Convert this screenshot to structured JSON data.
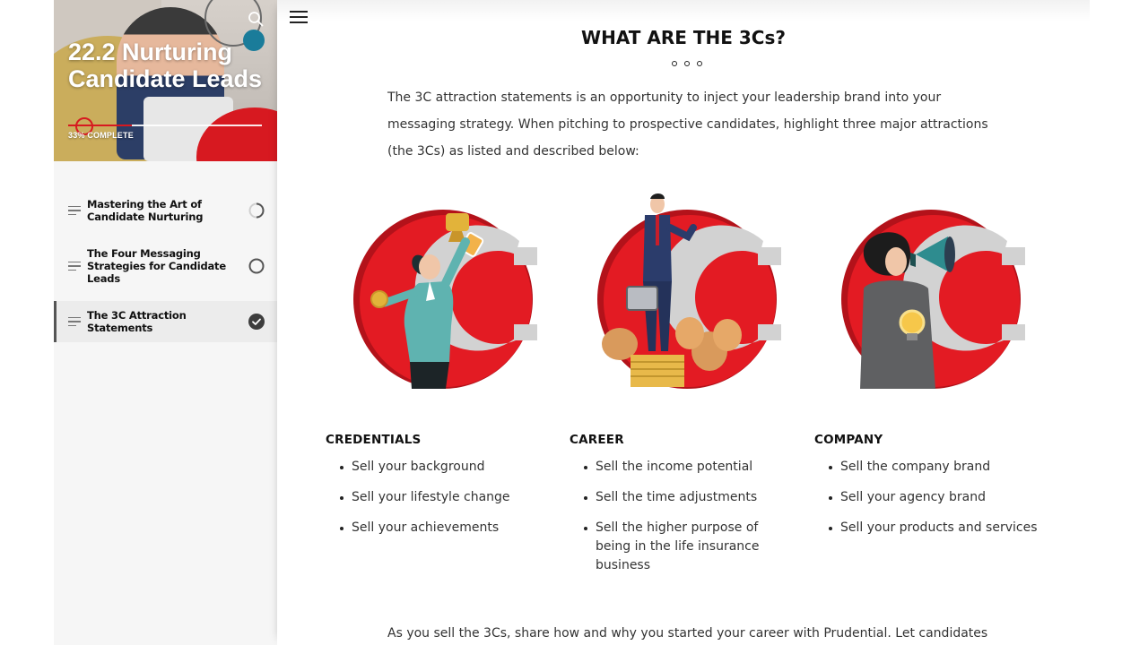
{
  "sidebar": {
    "lesson_title": "22.2 Nurturing Candidate Leads",
    "progress_percent": 33,
    "progress_label": "33% COMPLETE",
    "lessons": [
      {
        "label": "Mastering the Art of Candidate Nurturing",
        "status": "in-progress-icon"
      },
      {
        "label": "The Four Messaging Strategies for Candidate Leads",
        "status": "not-started-icon"
      },
      {
        "label": "The 3C Attraction Statements",
        "status": "check-complete-icon"
      }
    ]
  },
  "main": {
    "heading": "WHAT ARE THE 3Cs?",
    "intro": "The 3C attraction statements is an opportunity to inject your leadership brand into your messaging strategy. When pitching to prospective candidates, highlight three major attractions (the 3Cs) as listed and described below:",
    "columns": [
      {
        "title": "CREDENTIALS",
        "illustration": "trophy-person-illustration",
        "items": [
          "Sell your background",
          "Sell your lifestyle change",
          "Sell your achievements"
        ]
      },
      {
        "title": "CAREER",
        "illustration": "businessman-moneybags-illustration",
        "items": [
          "Sell the income potential",
          "Sell the time adjustments",
          "Sell the higher purpose of being in the life insurance business"
        ]
      },
      {
        "title": "COMPANY",
        "illustration": "megaphone-woman-illustration",
        "items": [
          "Sell the company brand",
          "Sell your agency brand",
          "Sell your products and services"
        ]
      }
    ],
    "outro": "As you sell the 3Cs, share how and why you started your career with Prudential. Let candidates"
  },
  "colors": {
    "brand_red": "#d71920",
    "teal_accent": "#1a7c9a",
    "gold_accent": "#c9a84a"
  }
}
